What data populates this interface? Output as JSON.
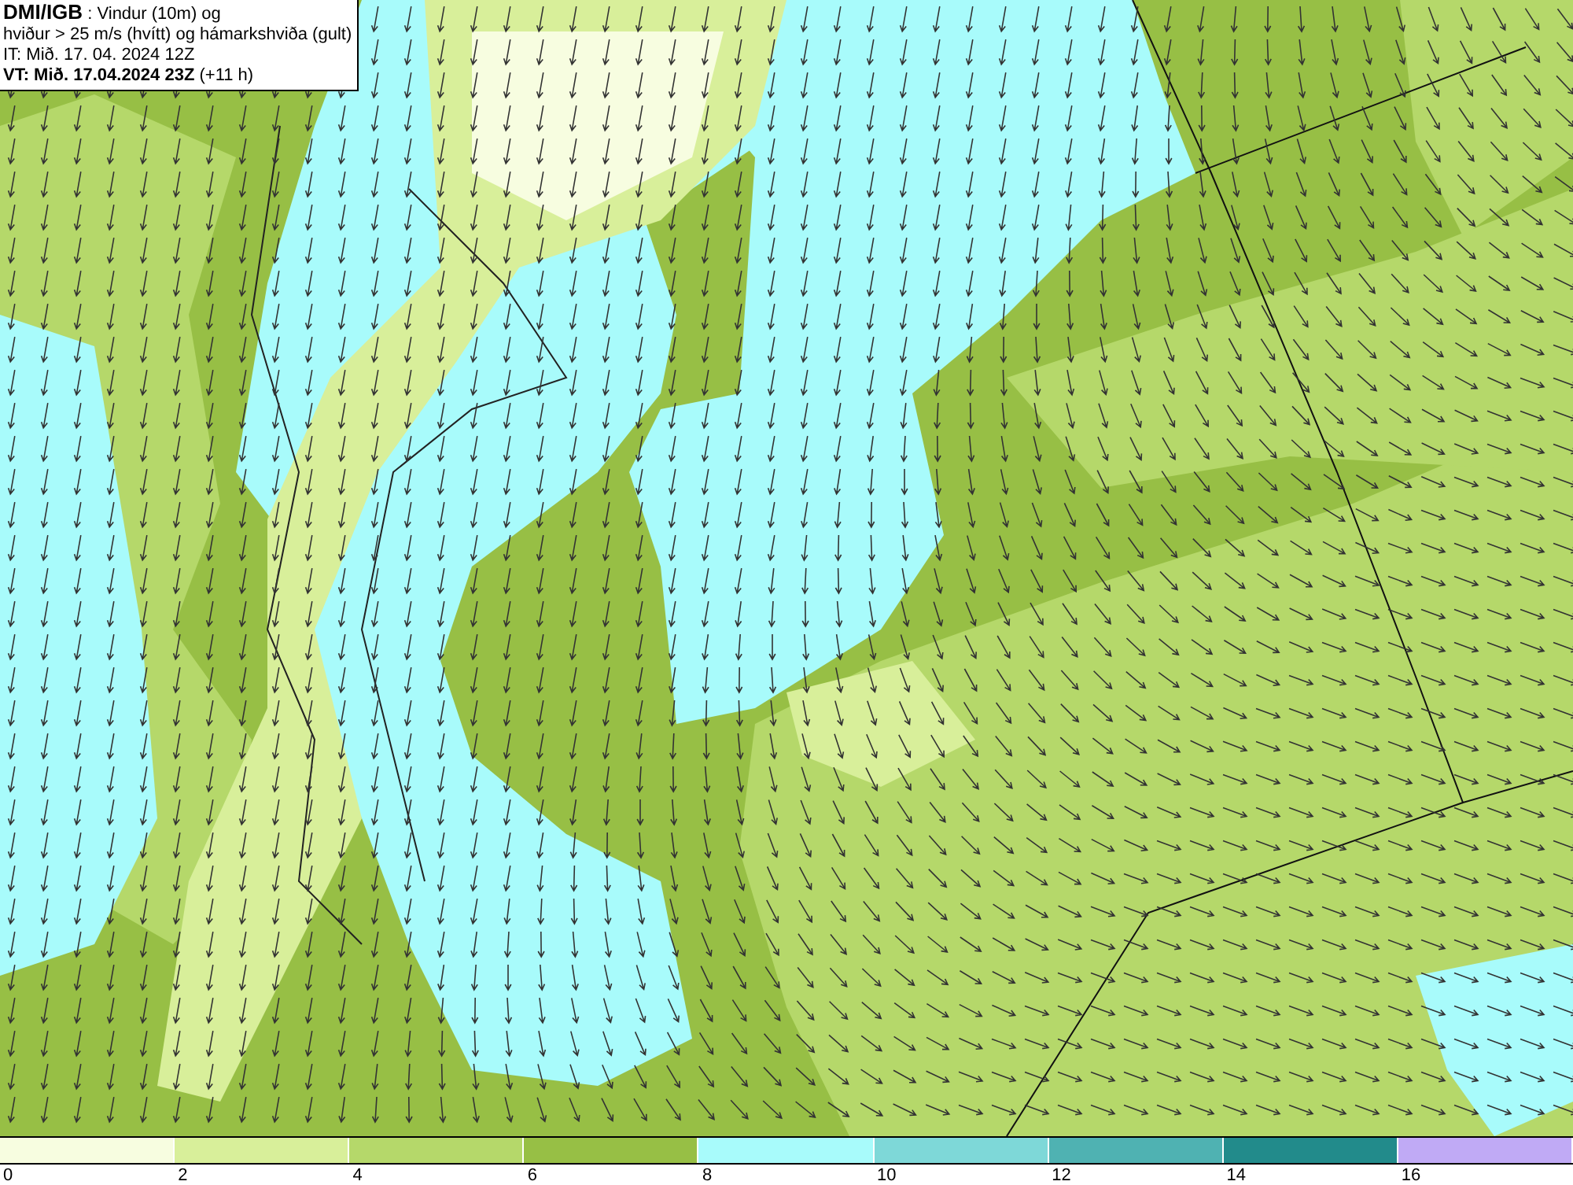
{
  "info_box": {
    "source": "DMI/IGB",
    "title_rest": " : Vindur (10m) og",
    "line_2": "hviður > 25 m/s (hvítt) og hámarkshviða (gult)",
    "initial_time": "IT: Mið. 17. 04. 2024 12Z",
    "valid_time": "VT: Mið. 17.04.2024 23Z",
    "lead": " (+11 h)"
  },
  "legend": {
    "segments": [
      {
        "color": "#f7fde0"
      },
      {
        "color": "#d8ef9a"
      },
      {
        "color": "#b5d86a"
      },
      {
        "color": "#97bf45"
      },
      {
        "color": "#a8fbfb"
      },
      {
        "color": "#7ed8d8"
      },
      {
        "color": "#4fb2b2"
      },
      {
        "color": "#228b8b"
      },
      {
        "color": "#c0aaf5"
      }
    ],
    "ticks": [
      "0",
      "2",
      "4",
      "6",
      "8",
      "10",
      "12",
      "14",
      "16"
    ]
  }
}
